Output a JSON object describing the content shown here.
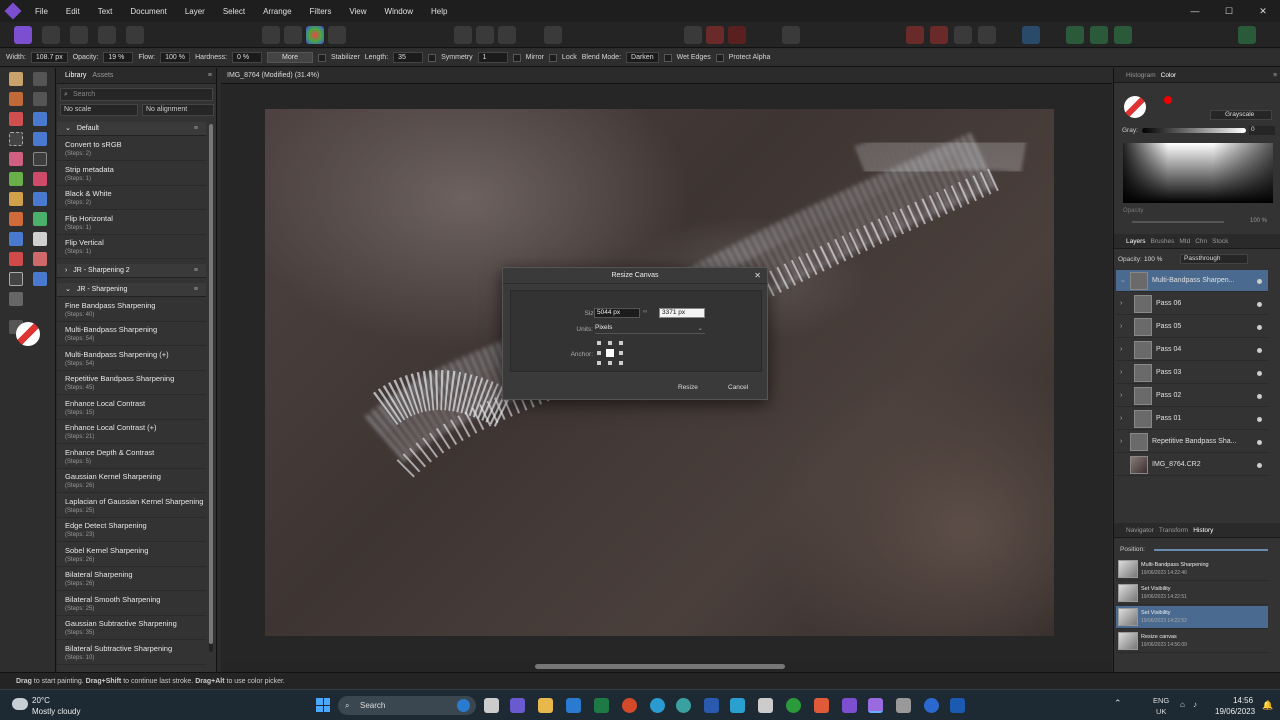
{
  "menu": [
    "File",
    "Edit",
    "Text",
    "Document",
    "Layer",
    "Select",
    "Arrange",
    "Filters",
    "View",
    "Window",
    "Help"
  ],
  "window_controls": {
    "minimize": "—",
    "maximize": "☐",
    "close": "✕"
  },
  "context": {
    "width_label": "Width:",
    "width_value": "108.7 px",
    "opacity_label": "Opacity:",
    "opacity_value": "19 %",
    "flow_label": "Flow:",
    "flow_value": "100 %",
    "hardness_label": "Hardness:",
    "hardness_value": "0 %",
    "more_label": "More",
    "stabilizer_label": "Stabilizer",
    "length_label": "Length:",
    "length_value": "35",
    "symmetry_label": "Symmetry",
    "symmetry_value": "1",
    "mirror_label": "Mirror",
    "lock_label": "Lock",
    "blend_label": "Blend Mode:",
    "blend_value": "Darken",
    "wet_edges_label": "Wet Edges",
    "protect_alpha_label": "Protect Alpha"
  },
  "library": {
    "tab_library": "Library",
    "tab_assets": "Assets",
    "search_placeholder": "Search",
    "scale_select": "No scale",
    "align_select": "No alignment",
    "groups": [
      {
        "name": "Default",
        "items": [
          {
            "t": "Convert to sRGB",
            "s": "(Steps: 2)"
          },
          {
            "t": "Strip metadata",
            "s": "(Steps: 1)"
          },
          {
            "t": "Black & White",
            "s": "(Steps: 2)"
          },
          {
            "t": "Flip Horizontal",
            "s": "(Steps: 1)"
          },
          {
            "t": "Flip Vertical",
            "s": "(Steps: 1)"
          }
        ]
      },
      {
        "name": "JR - Sharpening 2",
        "items": []
      },
      {
        "name": "JR - Sharpening",
        "items": [
          {
            "t": "Fine Bandpass Sharpening",
            "s": "(Steps: 40)"
          },
          {
            "t": "Multi-Bandpass Sharpening",
            "s": "(Steps: 54)"
          },
          {
            "t": "Multi-Bandpass Sharpening (+)",
            "s": "(Steps: 54)"
          },
          {
            "t": "Repetitive Bandpass Sharpening",
            "s": "(Steps: 45)"
          },
          {
            "t": "Enhance Local Contrast",
            "s": "(Steps: 15)"
          },
          {
            "t": "Enhance Local Contrast (+)",
            "s": "(Steps: 21)"
          },
          {
            "t": "Enhance Depth & Contrast",
            "s": "(Steps: 5)"
          },
          {
            "t": "Gaussian Kernel Sharpening",
            "s": "(Steps: 26)"
          },
          {
            "t": "Laplacian of Gaussian Kernel Sharpening",
            "s": "(Steps: 25)"
          },
          {
            "t": "Edge Detect Sharpening",
            "s": "(Steps: 23)"
          },
          {
            "t": "Sobel Kernel Sharpening",
            "s": "(Steps: 26)"
          },
          {
            "t": "Bilateral Sharpening",
            "s": "(Steps: 26)"
          },
          {
            "t": "Bilateral Smooth Sharpening",
            "s": "(Steps: 25)"
          },
          {
            "t": "Gaussian Subtractive Sharpening",
            "s": "(Steps: 35)"
          },
          {
            "t": "Bilateral Subtractive Sharpening",
            "s": "(Steps: 10)"
          }
        ]
      }
    ]
  },
  "document": {
    "tab_title": "IMG_8764 (Modified) (31.4%)"
  },
  "dialog": {
    "title": "Resize Canvas",
    "close": "✕",
    "size_label": "Size:",
    "width_value": "5044 px",
    "height_value": "3371 px",
    "units_label": "Units:",
    "units_value": "Pixels",
    "anchor_label": "Anchor:",
    "resize_label": "Resize",
    "cancel_label": "Cancel"
  },
  "right": {
    "tab_histogram": "Histogram",
    "tab_color": "Color",
    "color_mode": "Grayscale",
    "gray_label": "Gray:",
    "gray_value": "0",
    "opacity_label": "Opacity",
    "opacity_value": "100 %",
    "layer_tabs": [
      "Layers",
      "Brushes",
      "Mtd",
      "Chn",
      "Stock"
    ],
    "layers_opacity_label": "Opacity:",
    "layers_opacity_value": "100 %",
    "blend_value": "Passthrough",
    "layers": [
      "Multi-Bandpass Sharpen...",
      "Pass 06",
      "Pass 05",
      "Pass 04",
      "Pass 03",
      "Pass 02",
      "Pass 01",
      "Repetitive Bandpass Sha...",
      "IMG_8764.CR2"
    ],
    "hist_tabs": [
      "Navigator",
      "Transform",
      "History"
    ],
    "position_label": "Position:",
    "history": [
      {
        "a": "Multi-Bandpass Sharpening",
        "b": "19/06/2023 14:22:46"
      },
      {
        "a": "Set Visibility",
        "b": "19/06/2023 14:22:51"
      },
      {
        "a": "Set Visibility",
        "b": "19/06/2023 14:22:52"
      },
      {
        "a": "Resize canvas",
        "b": "19/06/2023 14:56:09"
      }
    ]
  },
  "status": {
    "parts": [
      "Drag",
      " to start painting. ",
      "Drag+Shift",
      " to continue last stroke. ",
      "Drag+Alt",
      " to use color picker."
    ]
  },
  "taskbar": {
    "temp": "20°C",
    "weather": "Mostly cloudy",
    "search": "Search",
    "lang1": "ENG",
    "lang2": "UK",
    "time": "14:56",
    "date": "19/06/2023"
  },
  "colors": {
    "accent": "#4a6a90",
    "app_purple": "#7b4fd0"
  }
}
